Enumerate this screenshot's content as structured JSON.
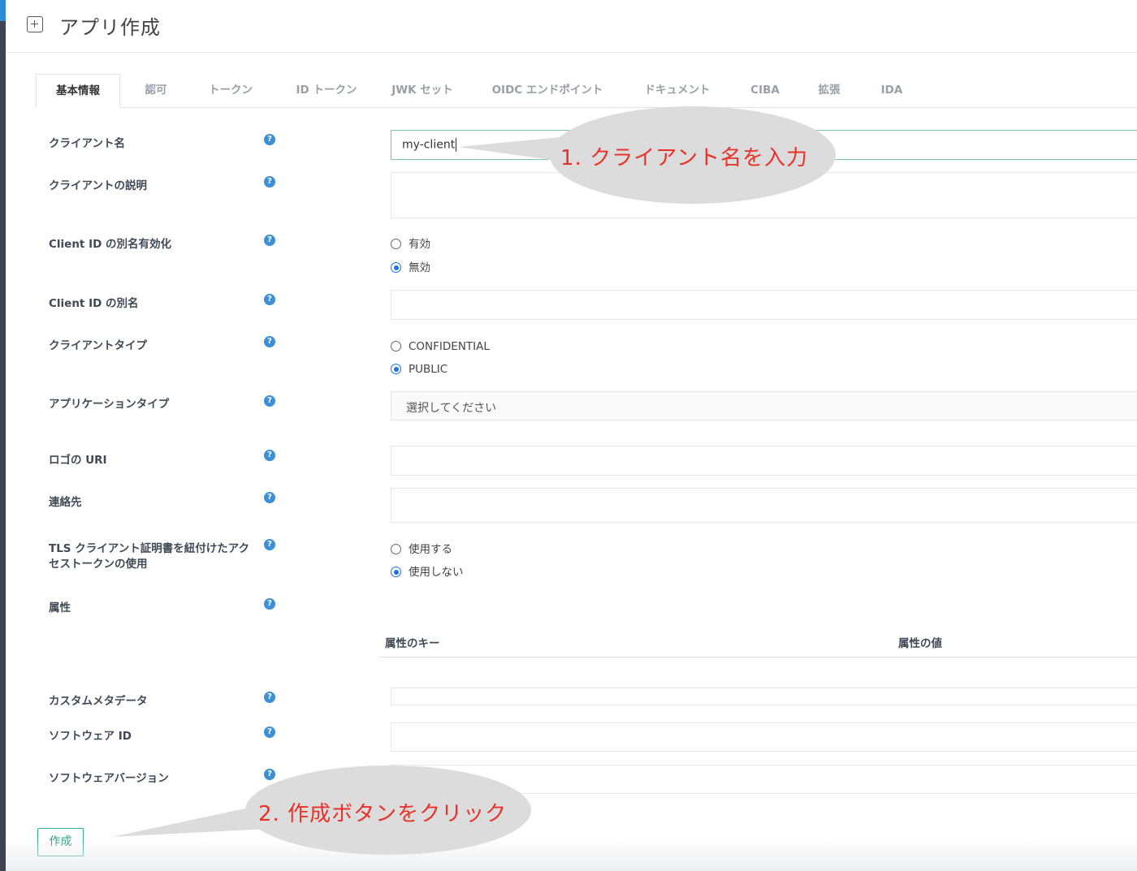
{
  "header": {
    "title": "アプリ作成",
    "icon": "plus-square-icon"
  },
  "tabs": [
    {
      "label": "基本情報",
      "active": true
    },
    {
      "label": "認可"
    },
    {
      "label": "トークン"
    },
    {
      "label": "ID トークン"
    },
    {
      "label": "JWK セット"
    },
    {
      "label": "OIDC エンドポイント"
    },
    {
      "label": "ドキュメント"
    },
    {
      "label": "CIBA"
    },
    {
      "label": "拡張"
    },
    {
      "label": "IDA"
    }
  ],
  "form": {
    "client_name": {
      "label": "クライアント名",
      "value": "my-client"
    },
    "client_description": {
      "label": "クライアントの説明",
      "value": ""
    },
    "client_id_alias_enabled": {
      "label": "Client ID の別名有効化",
      "options": [
        "有効",
        "無効"
      ],
      "selected": "無効"
    },
    "client_id_alias": {
      "label": "Client ID の別名",
      "value": ""
    },
    "client_type": {
      "label": "クライアントタイプ",
      "options": [
        "CONFIDENTIAL",
        "PUBLIC"
      ],
      "selected": "PUBLIC"
    },
    "application_type": {
      "label": "アプリケーションタイプ",
      "value": "選択してください"
    },
    "logo_uri": {
      "label": "ロゴの URI",
      "value": ""
    },
    "contacts": {
      "label": "連絡先",
      "value": ""
    },
    "tls_bound_tokens": {
      "label": "TLS クライアント証明書を紐付けたアクセストークンの使用",
      "options": [
        "使用する",
        "使用しない"
      ],
      "selected": "使用しない"
    },
    "attributes": {
      "label": "属性",
      "key_header": "属性のキー",
      "value_header": "属性の値"
    },
    "custom_metadata": {
      "label": "カスタムメタデータ",
      "value": ""
    },
    "software_id": {
      "label": "ソフトウェア ID",
      "value": ""
    },
    "software_version": {
      "label": "ソフトウェアバージョン",
      "value": ""
    }
  },
  "help_glyph": "?",
  "create_button": {
    "label": "作成"
  },
  "annotations": [
    {
      "text": "1. クライアント名を入力",
      "color": "#e8322a"
    },
    {
      "text": "2. 作成ボタンをクリック",
      "color": "#e8322a"
    }
  ],
  "colors": {
    "accent_green": "#36a88a",
    "radio_blue": "#1a73e8",
    "help_blue": "#3d8fd6",
    "annotation_red": "#e8322a",
    "callout_gray": "#dcdcdc"
  }
}
